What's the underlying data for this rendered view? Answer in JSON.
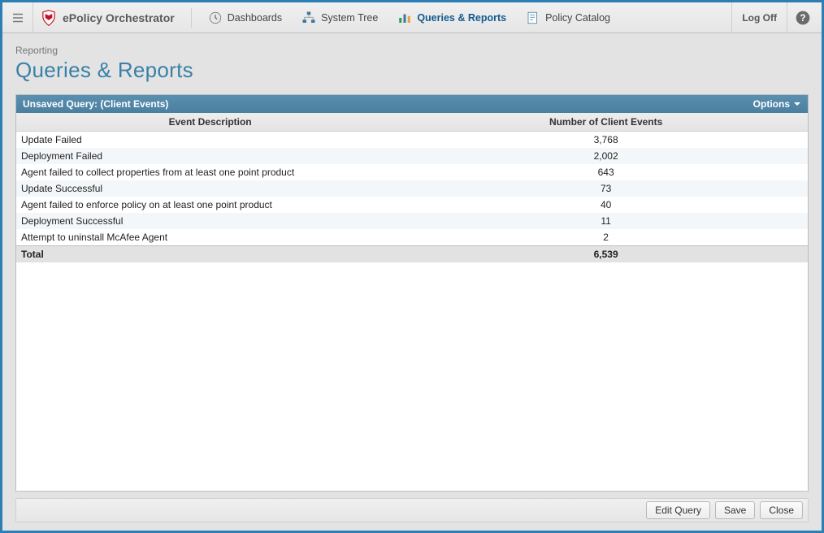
{
  "app": {
    "name": "ePolicy Orchestrator"
  },
  "topnav": {
    "items": [
      {
        "label": "Dashboards"
      },
      {
        "label": "System Tree"
      },
      {
        "label": "Queries & Reports"
      },
      {
        "label": "Policy Catalog"
      }
    ],
    "logoff": "Log Off"
  },
  "page": {
    "breadcrumb": "Reporting",
    "title": "Queries & Reports"
  },
  "panel": {
    "header": "Unsaved Query: (Client Events)",
    "options_label": "Options"
  },
  "table": {
    "columns": [
      "Event Description",
      "Number of Client Events"
    ],
    "rows": [
      {
        "desc": "Update Failed",
        "count": "3,768"
      },
      {
        "desc": "Deployment Failed",
        "count": "2,002"
      },
      {
        "desc": "Agent failed to collect properties from at least one point product",
        "count": "643"
      },
      {
        "desc": "Update Successful",
        "count": "73"
      },
      {
        "desc": "Agent failed to enforce policy on at least one point product",
        "count": "40"
      },
      {
        "desc": "Deployment Successful",
        "count": "11"
      },
      {
        "desc": "Attempt to uninstall McAfee Agent",
        "count": "2"
      }
    ],
    "total": {
      "label": "Total",
      "count": "6,539"
    }
  },
  "footer": {
    "edit_query": "Edit Query",
    "save": "Save",
    "close": "Close"
  },
  "chart_data": {
    "type": "table",
    "title": "Unsaved Query: (Client Events)",
    "columns": [
      "Event Description",
      "Number of Client Events"
    ],
    "rows": [
      [
        "Update Failed",
        3768
      ],
      [
        "Deployment Failed",
        2002
      ],
      [
        "Agent failed to collect properties from at least one point product",
        643
      ],
      [
        "Update Successful",
        73
      ],
      [
        "Agent failed to enforce policy on at least one point product",
        40
      ],
      [
        "Deployment Successful",
        11
      ],
      [
        "Attempt to uninstall McAfee Agent",
        2
      ]
    ],
    "total": 6539
  }
}
